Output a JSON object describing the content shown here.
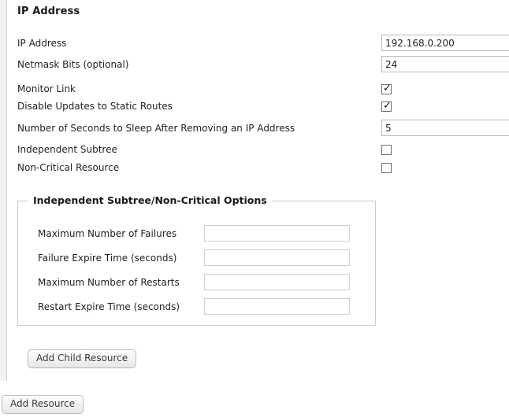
{
  "panel": {
    "title": "IP Address"
  },
  "properties": [
    {
      "label": "IP Address",
      "type": "text",
      "value": "192.168.0.200",
      "placeholder": "",
      "name": "ip-address"
    },
    {
      "label": "Netmask Bits (optional)",
      "type": "text",
      "value": "24",
      "placeholder": "",
      "name": "netmask-bits"
    },
    {
      "label": "Monitor Link",
      "type": "checkbox",
      "checked": true,
      "name": "monitor-link"
    },
    {
      "label": "Disable Updates to Static Routes",
      "type": "checkbox",
      "checked": true,
      "name": "disable-updates-to-static-routes"
    },
    {
      "label": "Number of Seconds to Sleep After Removing an IP Address",
      "type": "text",
      "value": "5",
      "placeholder": "",
      "name": "sleep-seconds-after-removing-ip"
    },
    {
      "label": "Independent Subtree",
      "type": "checkbox",
      "checked": false,
      "name": "independent-subtree"
    },
    {
      "label": "Non-Critical Resource",
      "type": "checkbox",
      "checked": false,
      "name": "non-critical-resource"
    }
  ],
  "subtree_options": {
    "legend": "Independent Subtree/Non-Critical Options",
    "fields": [
      {
        "label": "Maximum Number of Failures",
        "value": "",
        "placeholder": "",
        "name": "maximum-number-of-failures"
      },
      {
        "label": "Failure Expire Time (seconds)",
        "value": "",
        "placeholder": "",
        "name": "failure-expire-time"
      },
      {
        "label": "Maximum Number of Restarts",
        "value": "",
        "placeholder": "",
        "name": "maximum-number-of-restarts"
      },
      {
        "label": "Restart Expire Time (seconds)",
        "value": "",
        "placeholder": "",
        "name": "restart-expire-time"
      }
    ]
  },
  "buttons": {
    "add_child_resource": "Add Child Resource",
    "add_resource": "Add Resource"
  },
  "colors": {
    "page_background": "#ffffff",
    "gutter": "#f2f2f2",
    "panel_background": "#ffffff",
    "text": "#222222",
    "input_border": "#b9b9b9",
    "fieldset_border": "#c3cdd3",
    "button_border": "#bdbdbd"
  },
  "layout": {
    "row_tops": [
      44,
      71,
      102,
      124,
      152,
      179,
      202
    ],
    "fieldset_row_tops": [
      30,
      61,
      92,
      123
    ]
  }
}
